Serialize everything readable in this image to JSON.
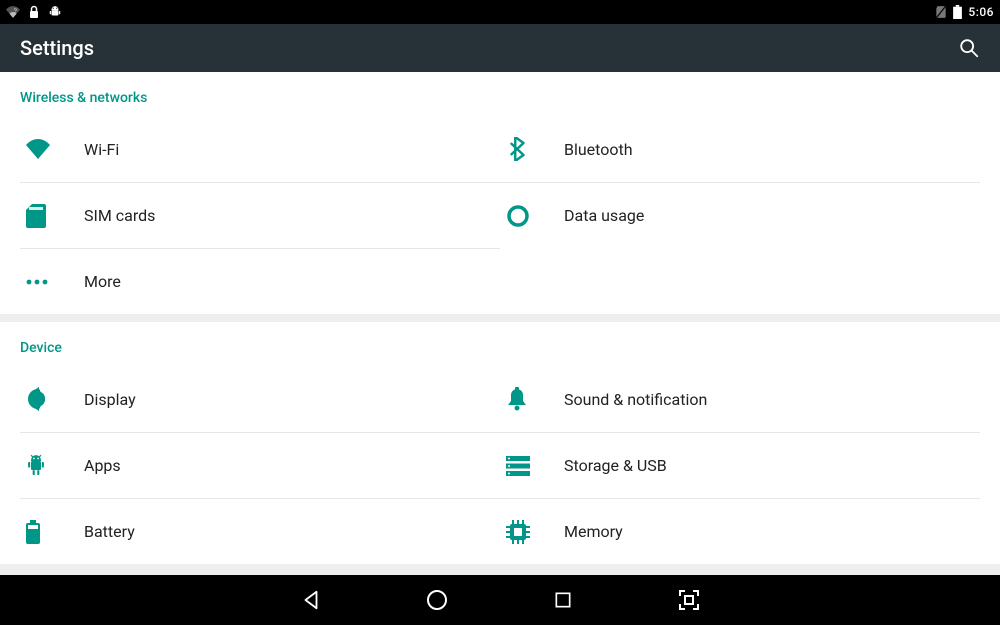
{
  "status": {
    "time": "5:06"
  },
  "appbar": {
    "title": "Settings"
  },
  "sections": {
    "wireless": {
      "title": "Wireless & networks",
      "wifi": "Wi-Fi",
      "bluetooth": "Bluetooth",
      "sim": "SIM cards",
      "datausage": "Data usage",
      "more": "More"
    },
    "device": {
      "title": "Device",
      "display": "Display",
      "sound": "Sound & notification",
      "apps": "Apps",
      "storage": "Storage & USB",
      "battery": "Battery",
      "memory": "Memory"
    }
  },
  "colors": {
    "accent": "#009688",
    "appbar": "#263238"
  }
}
